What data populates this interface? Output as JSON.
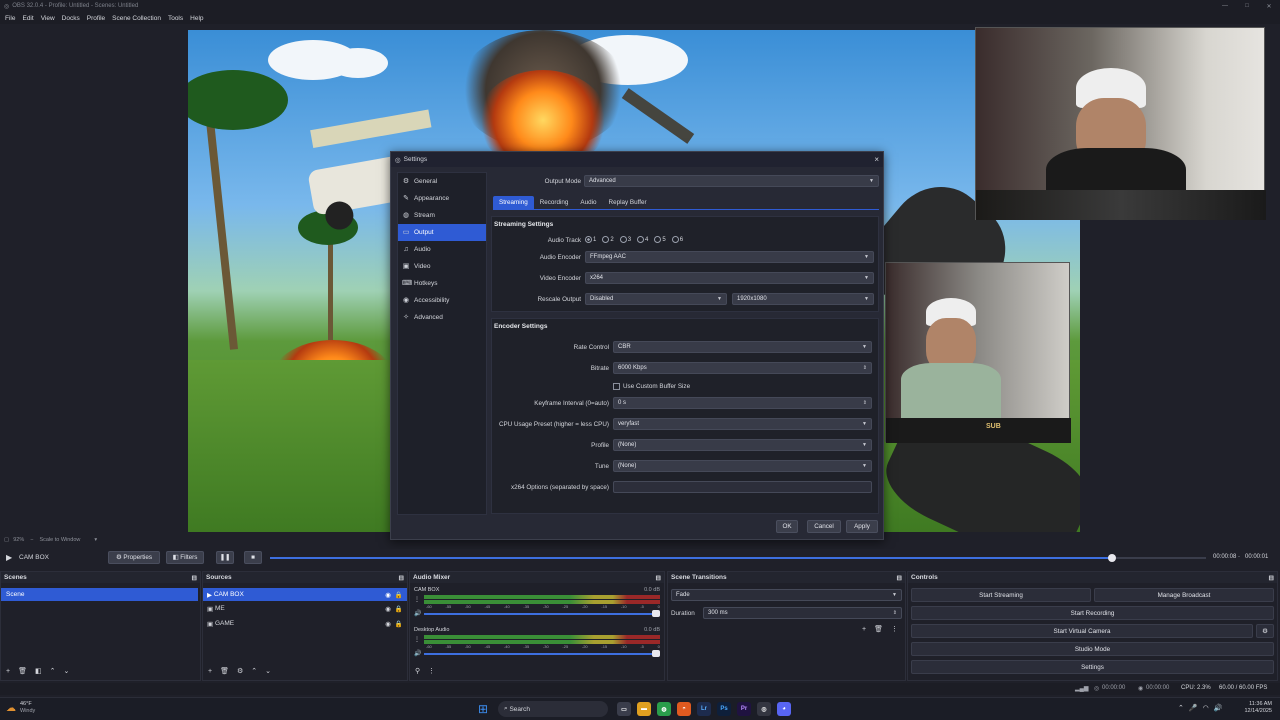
{
  "window": {
    "title": "OBS 32.0.4 - Profile: Untitled - Scenes: Untitled",
    "minimize": "—",
    "maximize": "□",
    "close": "✕"
  },
  "menu": [
    "File",
    "Edit",
    "View",
    "Docks",
    "Profile",
    "Scene Collection",
    "Tools",
    "Help"
  ],
  "preview": {
    "zoom": "92%",
    "scale_label": "Scale to Window",
    "cam_badge": "SUB"
  },
  "settings": {
    "title": "Settings",
    "nav": [
      {
        "label": "General",
        "icon": "gear-icon",
        "glyph": "⚙"
      },
      {
        "label": "Appearance",
        "icon": "brush-icon",
        "glyph": "✎"
      },
      {
        "label": "Stream",
        "icon": "globe-icon",
        "glyph": "◍"
      },
      {
        "label": "Output",
        "icon": "output-icon",
        "glyph": "▭"
      },
      {
        "label": "Audio",
        "icon": "speaker-icon",
        "glyph": "♫"
      },
      {
        "label": "Video",
        "icon": "monitor-icon",
        "glyph": "▣"
      },
      {
        "label": "Hotkeys",
        "icon": "keyboard-icon",
        "glyph": "⌨"
      },
      {
        "label": "Accessibility",
        "icon": "accessibility-icon",
        "glyph": "◉"
      },
      {
        "label": "Advanced",
        "icon": "wrench-icon",
        "glyph": "✧"
      }
    ],
    "output_mode_label": "Output Mode",
    "output_mode": "Advanced",
    "tabs": [
      "Streaming",
      "Recording",
      "Audio",
      "Replay Buffer"
    ],
    "streaming_settings": {
      "title": "Streaming Settings",
      "audio_track_label": "Audio Track",
      "audio_tracks": [
        "1",
        "2",
        "3",
        "4",
        "5",
        "6"
      ],
      "audio_encoder_label": "Audio Encoder",
      "audio_encoder": "FFmpeg AAC",
      "video_encoder_label": "Video Encoder",
      "video_encoder": "x264",
      "rescale_output_label": "Rescale Output",
      "rescale_output": "Disabled",
      "rescale_resolution": "1920x1080"
    },
    "encoder_settings": {
      "title": "Encoder Settings",
      "rate_control_label": "Rate Control",
      "rate_control": "CBR",
      "bitrate_label": "Bitrate",
      "bitrate": "6000 Kbps",
      "custom_buffer_label": "Use Custom Buffer Size",
      "keyframe_label": "Keyframe Interval (0=auto)",
      "keyframe": "0 s",
      "cpu_preset_label": "CPU Usage Preset (higher = less CPU)",
      "cpu_preset": "veryfast",
      "profile_label": "Profile",
      "profile": "(None)",
      "tune_label": "Tune",
      "tune": "(None)",
      "x264_options_label": "x264 Options (separated by space)",
      "x264_options": ""
    },
    "buttons": {
      "ok": "OK",
      "cancel": "Cancel",
      "apply": "Apply"
    }
  },
  "transport": {
    "source": "CAM BOX",
    "properties": "Properties",
    "filters": "Filters",
    "time_left": "00:00:08",
    "time_right": "00:00:01",
    "progress": 0.9
  },
  "docks": {
    "scenes": {
      "title": "Scenes",
      "items": [
        "Scene"
      ]
    },
    "sources": {
      "title": "Sources",
      "items": [
        "CAM BOX",
        "ME",
        "GAME"
      ]
    },
    "mixer": {
      "title": "Audio Mixer",
      "channels": [
        {
          "name": "CAM BOX",
          "db": "0.0 dB",
          "ticks": [
            "-60",
            "-55",
            "-50",
            "-45",
            "-40",
            "-35",
            "-30",
            "-25",
            "-20",
            "-15",
            "-10",
            "-5",
            "0"
          ]
        },
        {
          "name": "Desktop Audio",
          "db": "0.0 dB",
          "ticks": [
            "-60",
            "-55",
            "-50",
            "-45",
            "-40",
            "-35",
            "-30",
            "-25",
            "-20",
            "-15",
            "-10",
            "-5",
            "0"
          ]
        }
      ]
    },
    "transitions": {
      "title": "Scene Transitions",
      "type": "Fade",
      "duration_label": "Duration",
      "duration": "300 ms"
    },
    "controls": {
      "title": "Controls",
      "start_streaming": "Start Streaming",
      "manage_broadcast": "Manage Broadcast",
      "start_recording": "Start Recording",
      "start_virtual_camera": "Start Virtual Camera",
      "studio_mode": "Studio Mode",
      "settings": "Settings"
    }
  },
  "status": {
    "stream_time": "00:00:00",
    "rec_time": "00:00:00",
    "cpu": "CPU: 2.3%",
    "fps": "60.00 / 60.00 FPS"
  },
  "taskbar": {
    "weather_temp": "46°F",
    "weather_desc": "Windy",
    "search": "Search",
    "time": "11:36 AM",
    "date": "12/14/2025"
  }
}
